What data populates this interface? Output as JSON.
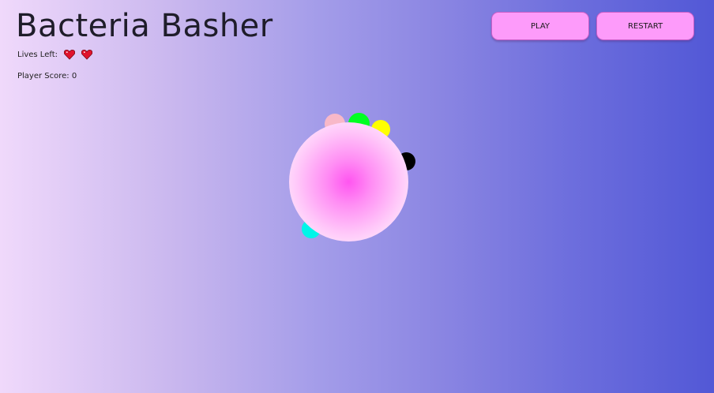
{
  "game": {
    "title": "Bacteria Basher",
    "lives_label": "Lives Left:",
    "lives_count": 2,
    "score_label": "Player Score:",
    "score_value": "0",
    "play_button": "PLAY",
    "restart_button": "RESTART"
  },
  "colors": {
    "button_fill": "#fd9bfa",
    "heart": "#e0132d",
    "dish_center": "#ff55f0",
    "background_left": "#f0d9fb",
    "background_right": "#5258d6"
  },
  "bacteria": [
    {
      "color": "#f8b8c8"
    },
    {
      "color": "#00ff21"
    },
    {
      "color": "#ffff00"
    },
    {
      "color": "#000000"
    },
    {
      "color": "#00f5e8"
    }
  ]
}
